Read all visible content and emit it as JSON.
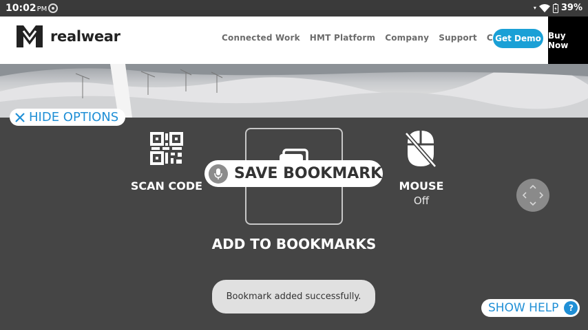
{
  "status_bar": {
    "time": "10:02",
    "ampm": "PM",
    "battery": "39%"
  },
  "site": {
    "logo_text": "realwear",
    "nav": [
      "Connected Work",
      "HMT Platform",
      "Company",
      "Support",
      "Contact"
    ],
    "demo_label": "Get Demo",
    "buy_label": "Buy Now",
    "accent": "#1aa0d6"
  },
  "overlay": {
    "hide_options": "HIDE OPTIONS",
    "scan_code": "SCAN CODE",
    "mouse": "MOUSE",
    "mouse_state": "Off",
    "voice_command": "SAVE BOOKMARK",
    "add_to_bookmarks": "ADD TO BOOKMARKS",
    "toast": "Bookmark added successfully.",
    "show_help": "SHOW HELP",
    "help_icon": "?"
  },
  "icons": [
    "sync-icon",
    "wifi-icon",
    "battery-icon",
    "realwear-logo-icon",
    "close-icon",
    "qr-code-icon",
    "bookmark-icon",
    "microphone-icon",
    "mouse-off-icon",
    "direction-pad-icon",
    "help-icon"
  ]
}
